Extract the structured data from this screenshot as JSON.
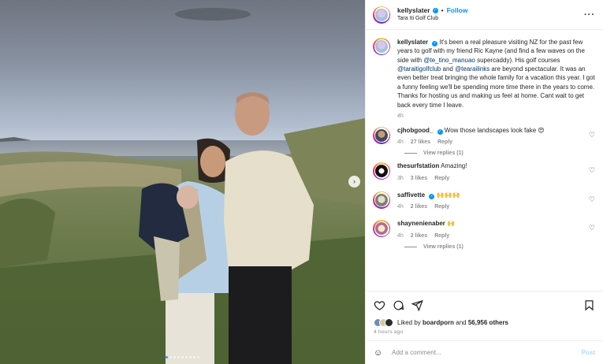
{
  "post": {
    "carousel": {
      "count": 9,
      "active_index": 0,
      "next_icon": "chevron-right-icon"
    }
  },
  "header": {
    "username": "kellyslater",
    "separator": "•",
    "follow_label": "Follow",
    "location": "Tara Iti Golf Club",
    "more_icon": "more-horizontal-icon"
  },
  "caption": {
    "username": "kellyslater",
    "parts": [
      "It's been a real pleasure visiting NZ for the past few years to golf with my friend Ric Kayne (and find a few waves on the side with ",
      "@te_tino_manuao",
      " supercaddy). His golf courses ",
      "@taraitigolfclub",
      " and ",
      "@tearailinks",
      " are beyond spectacular. It was an even better treat bringing the whole family for a vacation this year. I got a funny feeling we'll be spending more time there in the years to come. Thanks for hosting us and making us feel at home. Cant wait to get back every time I leave."
    ],
    "time": "4h"
  },
  "comments": [
    {
      "username": "cjhobgood_",
      "verified": true,
      "text": "Wow those landscapes look fake 😍",
      "time": "4h",
      "likes": "27 likes",
      "reply_label": "Reply",
      "view_replies": "View replies (1)"
    },
    {
      "username": "thesurfstation",
      "verified": false,
      "text": "Amazing!",
      "time": "3h",
      "likes": "3 likes",
      "reply_label": "Reply",
      "view_replies": ""
    },
    {
      "username": "saffivette",
      "verified": true,
      "text": "🙌🙌🙌",
      "time": "4h",
      "likes": "2 likes",
      "reply_label": "Reply",
      "view_replies": ""
    },
    {
      "username": "shaynenienaber",
      "verified": false,
      "text": "🙌",
      "time": "4h",
      "likes": "2 likes",
      "reply_label": "Reply",
      "view_replies": "View replies (1)"
    }
  ],
  "actions": {
    "like_icon": "heart-icon",
    "comment_icon": "comment-icon",
    "share_icon": "share-icon",
    "save_icon": "bookmark-icon",
    "liked_by_prefix": "Liked by",
    "liked_by_user": "boardporn",
    "liked_by_and": "and",
    "liked_by_count": "56,956 others",
    "timestamp": "4 hours ago"
  },
  "add_comment": {
    "emoji_icon": "emoji-icon",
    "placeholder": "Add a comment...",
    "post_label": "Post"
  },
  "colors": {
    "accent": "#0095f6",
    "link": "#00376b",
    "muted": "#8e8e8e",
    "post_disabled": "#b3dbff"
  }
}
